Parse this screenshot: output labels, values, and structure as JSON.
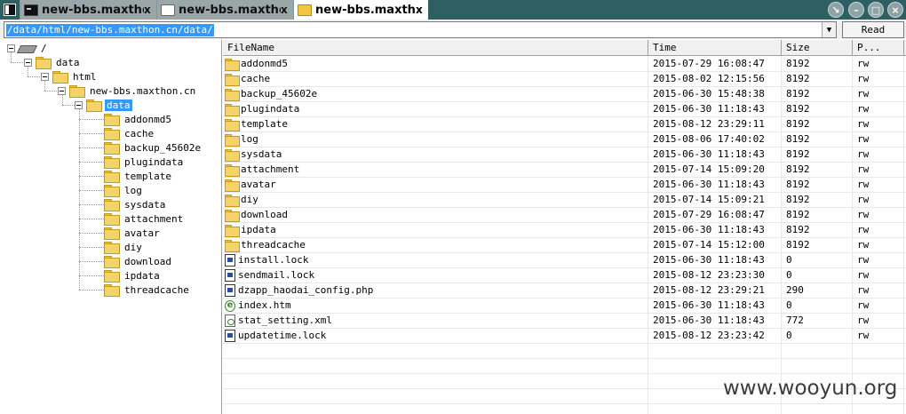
{
  "tabs": [
    {
      "label": "new-bbs.maxthon.cn",
      "icon": "terminal-icon",
      "close": "x",
      "active": false
    },
    {
      "label": "new-bbs.maxthon.cn",
      "icon": "blank-page-icon",
      "close": "x",
      "active": false
    },
    {
      "label": "new-bbs.maxthon.cn",
      "icon": "folder-icon",
      "close": "x",
      "active": true
    }
  ],
  "window_controls": {
    "restore": "↘",
    "minimize": "–",
    "maximize": "□",
    "close": "×"
  },
  "address": {
    "path": "/data/html/new-bbs.maxthon.cn/data/",
    "dropdown_glyph": "▼"
  },
  "read_button": "Read",
  "tree": {
    "root": "/",
    "data": "data",
    "html": "html",
    "site": "new-bbs.maxthon.cn",
    "selected": "data",
    "children": [
      "addonmd5",
      "cache",
      "backup_45602e",
      "plugindata",
      "template",
      "log",
      "sysdata",
      "attachment",
      "avatar",
      "diy",
      "download",
      "ipdata",
      "threadcache"
    ]
  },
  "columns": {
    "name": "FileName",
    "time": "Time",
    "size": "Size",
    "perm": "P..."
  },
  "files": [
    {
      "name": "addonmd5",
      "time": "2015-07-29 16:08:47",
      "size": "8192",
      "perm": "rw",
      "type": "folder"
    },
    {
      "name": "cache",
      "time": "2015-08-02 12:15:56",
      "size": "8192",
      "perm": "rw",
      "type": "folder"
    },
    {
      "name": "backup_45602e",
      "time": "2015-06-30 15:48:38",
      "size": "8192",
      "perm": "rw",
      "type": "folder"
    },
    {
      "name": "plugindata",
      "time": "2015-06-30 11:18:43",
      "size": "8192",
      "perm": "rw",
      "type": "folder"
    },
    {
      "name": "template",
      "time": "2015-08-12 23:29:11",
      "size": "8192",
      "perm": "rw",
      "type": "folder"
    },
    {
      "name": "log",
      "time": "2015-08-06 17:40:02",
      "size": "8192",
      "perm": "rw",
      "type": "folder"
    },
    {
      "name": "sysdata",
      "time": "2015-06-30 11:18:43",
      "size": "8192",
      "perm": "rw",
      "type": "folder"
    },
    {
      "name": "attachment",
      "time": "2015-07-14 15:09:20",
      "size": "8192",
      "perm": "rw",
      "type": "folder"
    },
    {
      "name": "avatar",
      "time": "2015-06-30 11:18:43",
      "size": "8192",
      "perm": "rw",
      "type": "folder"
    },
    {
      "name": "diy",
      "time": "2015-07-14 15:09:21",
      "size": "8192",
      "perm": "rw",
      "type": "folder"
    },
    {
      "name": "download",
      "time": "2015-07-29 16:08:47",
      "size": "8192",
      "perm": "rw",
      "type": "folder"
    },
    {
      "name": "ipdata",
      "time": "2015-06-30 11:18:43",
      "size": "8192",
      "perm": "rw",
      "type": "folder"
    },
    {
      "name": "threadcache",
      "time": "2015-07-14 15:12:00",
      "size": "8192",
      "perm": "rw",
      "type": "folder"
    },
    {
      "name": "install.lock",
      "time": "2015-06-30 11:18:43",
      "size": "0",
      "perm": "rw",
      "type": "file"
    },
    {
      "name": "sendmail.lock",
      "time": "2015-08-12 23:23:30",
      "size": "0",
      "perm": "rw",
      "type": "file"
    },
    {
      "name": "dzapp_haodai_config.php",
      "time": "2015-08-12 23:29:21",
      "size": "290",
      "perm": "rw",
      "type": "file"
    },
    {
      "name": "index.htm",
      "time": "2015-06-30 11:18:43",
      "size": "0",
      "perm": "rw",
      "type": "html"
    },
    {
      "name": "stat_setting.xml",
      "time": "2015-06-30 11:18:43",
      "size": "772",
      "perm": "rw",
      "type": "xml"
    },
    {
      "name": "updatetime.lock",
      "time": "2015-08-12 23:23:42",
      "size": "0",
      "perm": "rw",
      "type": "file"
    }
  ],
  "watermark": "www.wooyun.org",
  "colors": {
    "titlebar": "#2e5f63",
    "selection": "#3399ff"
  }
}
